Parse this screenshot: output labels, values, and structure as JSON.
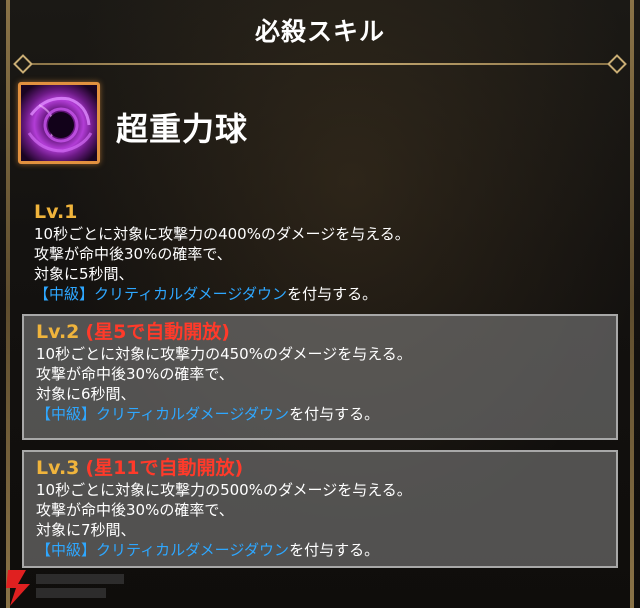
{
  "header": {
    "title": "必殺スキル"
  },
  "skill": {
    "icon": "purple-gravity-orb-icon",
    "name": "超重力球"
  },
  "levels": [
    {
      "label": "Lv.1",
      "unlock": "",
      "line1": "10秒ごとに対象に攻撃力の400%のダメージを与える。",
      "line2": "攻撃が命中後30%の確率で、",
      "line3": "対象に5秒間、",
      "debuff": "【中級】クリティカルダメージダウン",
      "suffix": "を付与する。"
    },
    {
      "label": "Lv.2",
      "unlock": "(星5で自動開放)",
      "line1": "10秒ごとに対象に攻撃力の450%のダメージを与える。",
      "line2": "攻撃が命中後30%の確率で、",
      "line3": "対象に6秒間、",
      "debuff": "【中級】クリティカルダメージダウン",
      "suffix": "を付与する。"
    },
    {
      "label": "Lv.3",
      "unlock": "(星11で自動開放)",
      "line1": "10秒ごとに対象に攻撃力の500%のダメージを与える。",
      "line2": "攻撃が命中後30%の確率で、",
      "line3": "対象に7秒間、",
      "debuff": "【中級】クリティカルダメージダウン",
      "suffix": "を付与する。"
    }
  ],
  "colors": {
    "level_label": "#f0b43c",
    "unlock_text": "#ff3a2a",
    "debuff_text": "#2ea7ff",
    "icon_border": "#e2913f",
    "frame_gold": "#c9ad74"
  }
}
